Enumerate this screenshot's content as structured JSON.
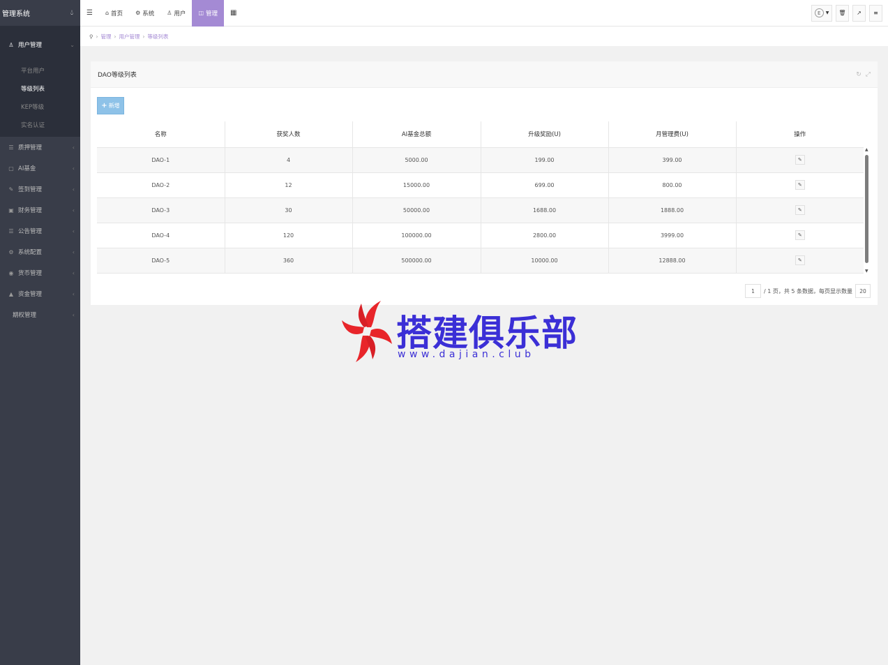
{
  "app": {
    "title": "管理系统",
    "toggle_icon": "droplet-icon"
  },
  "sidebar": {
    "open_group": {
      "icon": "user-icon",
      "label": "用户管理",
      "items": [
        "平台用户",
        "等级列表",
        "KEP等级",
        "实名认证"
      ],
      "active_index": 1
    },
    "groups": [
      {
        "icon": "list-icon",
        "label": "质押管理"
      },
      {
        "icon": "monitor-icon",
        "label": "AI基金"
      },
      {
        "icon": "edit-icon",
        "label": "签到管理"
      },
      {
        "icon": "card-icon",
        "label": "财务管理"
      },
      {
        "icon": "list-icon",
        "label": "公告管理"
      },
      {
        "icon": "gears-icon",
        "label": "系统配置"
      },
      {
        "icon": "coin-icon",
        "label": "货币管理"
      },
      {
        "icon": "bank-icon",
        "label": "资金管理"
      },
      {
        "icon": "",
        "label": "期权管理"
      }
    ]
  },
  "topbar": {
    "menu_icon": "hamburger-icon",
    "items": [
      {
        "icon": "home-icon",
        "label": "首页"
      },
      {
        "icon": "gear-icon",
        "label": "系统"
      },
      {
        "icon": "user-icon",
        "label": "用户"
      },
      {
        "icon": "bag-icon",
        "label": "管理"
      }
    ],
    "active_index": 3,
    "grid_icon": "grid-icon",
    "user_avatar_text": "E",
    "right_buttons": [
      "trash-icon",
      "external-link-icon",
      "menu-list-icon"
    ]
  },
  "breadcrumb": [
    "管理",
    "用户管理",
    "等级列表"
  ],
  "panel": {
    "title": "DAO等级列表",
    "add_label": "新增",
    "columns": [
      "名称",
      "获奖人数",
      "AI基金总额",
      "升级奖励(U)",
      "月管理费(U)",
      "操作"
    ],
    "rows": [
      [
        "DAO-1",
        "4",
        "5000.00",
        "199.00",
        "399.00"
      ],
      [
        "DAO-2",
        "12",
        "15000.00",
        "699.00",
        "800.00"
      ],
      [
        "DAO-3",
        "30",
        "50000.00",
        "1688.00",
        "1888.00"
      ],
      [
        "DAO-4",
        "120",
        "100000.00",
        "2800.00",
        "3999.00"
      ],
      [
        "DAO-5",
        "360",
        "500000.00",
        "10000.00",
        "12888.00"
      ]
    ],
    "pager": {
      "page": "1",
      "text": "/ 1 页，共 5 条数据，每页显示数量",
      "size": "20"
    }
  },
  "watermark": {
    "title": "搭建俱乐部",
    "url": "www.dajian.club"
  },
  "colors": {
    "sidebar": "#393d49",
    "accent": "#a48ad4",
    "add_button": "#8ec2e8",
    "watermark": "#3b2fd6"
  }
}
